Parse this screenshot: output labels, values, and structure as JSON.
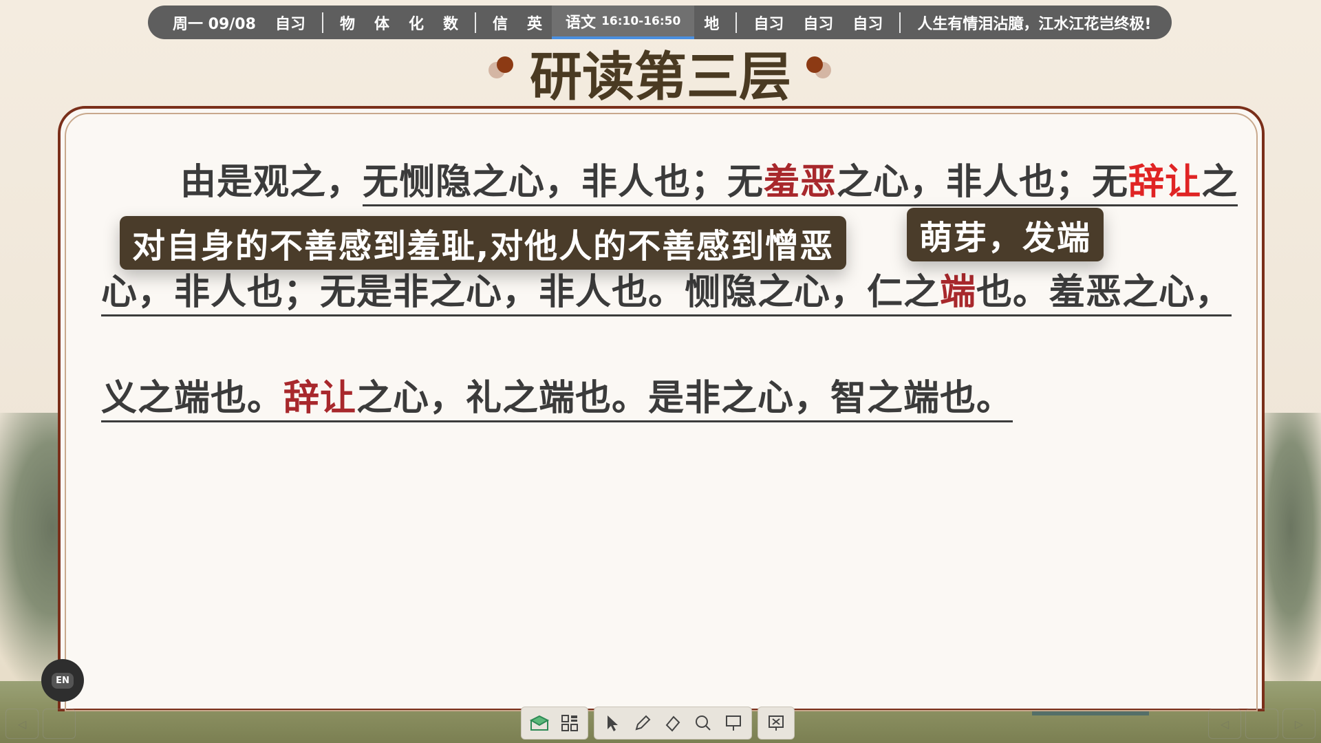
{
  "schedule": {
    "date": "周一 09/08",
    "items_a": [
      "自习"
    ],
    "items_b": [
      "物",
      "体",
      "化",
      "数"
    ],
    "items_c": [
      "信",
      "英"
    ],
    "current": {
      "subject": "语文",
      "time": "16:10-16:50"
    },
    "items_d": [
      "地"
    ],
    "items_e": [
      "自习",
      "自习",
      "自习"
    ],
    "motto": "人生有情泪沾臆，江水江花岂终极!"
  },
  "slide": {
    "title": "研读第三层",
    "line1": {
      "indent_text": "由是观之，",
      "seg1": "无恻隐之心，非人也；无",
      "red1": "羞恶",
      "seg2": "之心，非人也；无",
      "red2": "辞让",
      "seg3": "之"
    },
    "line2": {
      "seg1": "心，非人也；无是非之心，非人也。恻隐之心，仁之",
      "red1": "端",
      "seg2": "也。羞恶之心，"
    },
    "line3": {
      "seg1": "义之端也。",
      "red1": "辞让",
      "seg2": "之心，礼之端也。是非之心，智之端也。"
    },
    "tooltip1": "对自身的不善感到羞耻,对他人的不善感到憎恶",
    "tooltip2": "萌芽，发端"
  },
  "toolbar": {
    "icons": [
      "envelope-icon",
      "grid-icon",
      "pointer-icon",
      "pen-icon",
      "eraser-icon",
      "search-icon",
      "whiteboard-icon",
      "close-screen-icon"
    ]
  },
  "input_badge": "EN",
  "colors": {
    "accent_red": "#e02424",
    "dark_red": "#a8282c",
    "frame": "#7a2f1a",
    "tooltip_bg": "#4a3c2a"
  }
}
